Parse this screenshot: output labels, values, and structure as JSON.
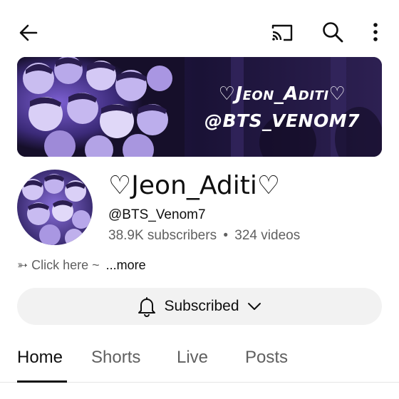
{
  "header": {
    "icons": [
      "back-arrow-icon",
      "cast-icon",
      "search-icon",
      "more-vert-icon"
    ]
  },
  "banner": {
    "line1": "♡Jeon_Aditi♡",
    "line2": "@BTS_VENOM7",
    "colors": {
      "background": "#160f2a",
      "glow": "#7b5fd0"
    }
  },
  "channel": {
    "name": "♡Jeon_Aditi♡",
    "handle": "@BTS_Venom7",
    "subscribers": "38.9K subscribers",
    "separator": "•",
    "videos": "324 videos"
  },
  "description": {
    "text": "➳ Click here ~",
    "more_label": "...more"
  },
  "subscribe": {
    "label": "Subscribed",
    "icons": [
      "bell-icon",
      "chevron-down-icon"
    ]
  },
  "tabs": [
    {
      "label": "Home",
      "active": true
    },
    {
      "label": "Shorts",
      "active": false
    },
    {
      "label": "Live",
      "active": false
    },
    {
      "label": "Posts",
      "active": false
    }
  ],
  "colors": {
    "text_primary": "#0f0f0f",
    "text_secondary": "#606060",
    "button_bg": "#f2f2f2"
  }
}
